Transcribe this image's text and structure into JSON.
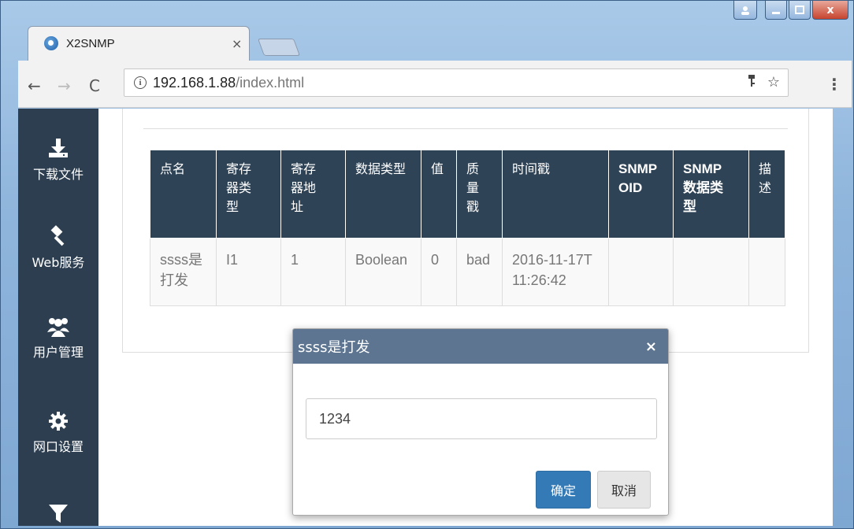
{
  "browser": {
    "tab_title": "X2SNMP",
    "tab_close": "×",
    "url_host": "192.168.1.88",
    "url_path": "/index.html",
    "info_glyph": "i",
    "window_close": "x"
  },
  "sidebar": {
    "items": [
      {
        "label": "下载文件",
        "icon": "download-icon"
      },
      {
        "label": "Web服务",
        "icon": "gavel-icon"
      },
      {
        "label": "用户管理",
        "icon": "users-icon"
      },
      {
        "label": "网口设置",
        "icon": "gear-icon"
      },
      {
        "label": "",
        "icon": "filter-icon"
      }
    ]
  },
  "table": {
    "headers": [
      "点名",
      "寄存器类型",
      "寄存器地址",
      "数据类型",
      "值",
      "质量戳",
      "时间戳",
      "SNMP OID",
      "SNMP数据类型",
      "描述"
    ],
    "rows": [
      {
        "name": "ssss是打发",
        "register_type": "I1",
        "register_address": "1",
        "data_type": "Boolean",
        "value": "0",
        "quality": "bad",
        "timestamp": "2016-11-17T11:26:42",
        "snmp_oid": "",
        "snmp_type": "",
        "description": ""
      }
    ]
  },
  "modal": {
    "title": "ssss是打发",
    "close_glyph": "×",
    "input_value": "1234",
    "ok_label": "确定",
    "cancel_label": "取消"
  },
  "colors": {
    "sidebar_bg": "#2c3e50",
    "table_header_bg": "#2f4356",
    "modal_header_bg": "#5d7591",
    "primary_button": "#337ab7"
  }
}
